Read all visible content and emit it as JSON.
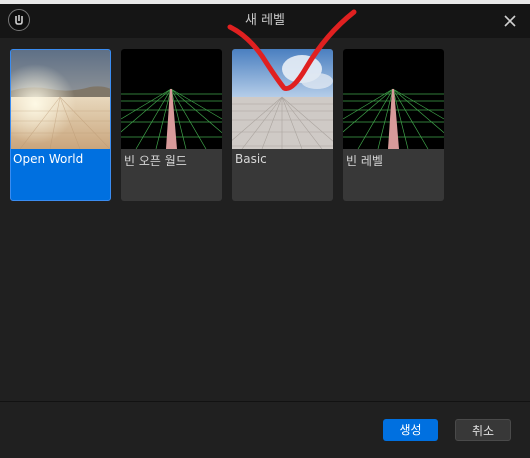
{
  "window": {
    "title": "새 레벨",
    "logo_icon": "unreal-engine-logo-icon",
    "close_icon": "close-icon"
  },
  "templates": [
    {
      "label": "Open World",
      "selected": true,
      "thumbnail": "desert-landscape"
    },
    {
      "label": "빈 오픈 월드",
      "selected": false,
      "thumbnail": "grid-with-path"
    },
    {
      "label": "Basic",
      "selected": false,
      "thumbnail": "sky-with-tiled-floor"
    },
    {
      "label": "빈 레벨",
      "selected": false,
      "thumbnail": "grid-with-path"
    }
  ],
  "footer": {
    "create_label": "생성",
    "cancel_label": "취소"
  },
  "colors": {
    "accent": "#0070e0",
    "background": "#202020",
    "titlebar": "#151515",
    "annotation_mark": "#e02020"
  }
}
